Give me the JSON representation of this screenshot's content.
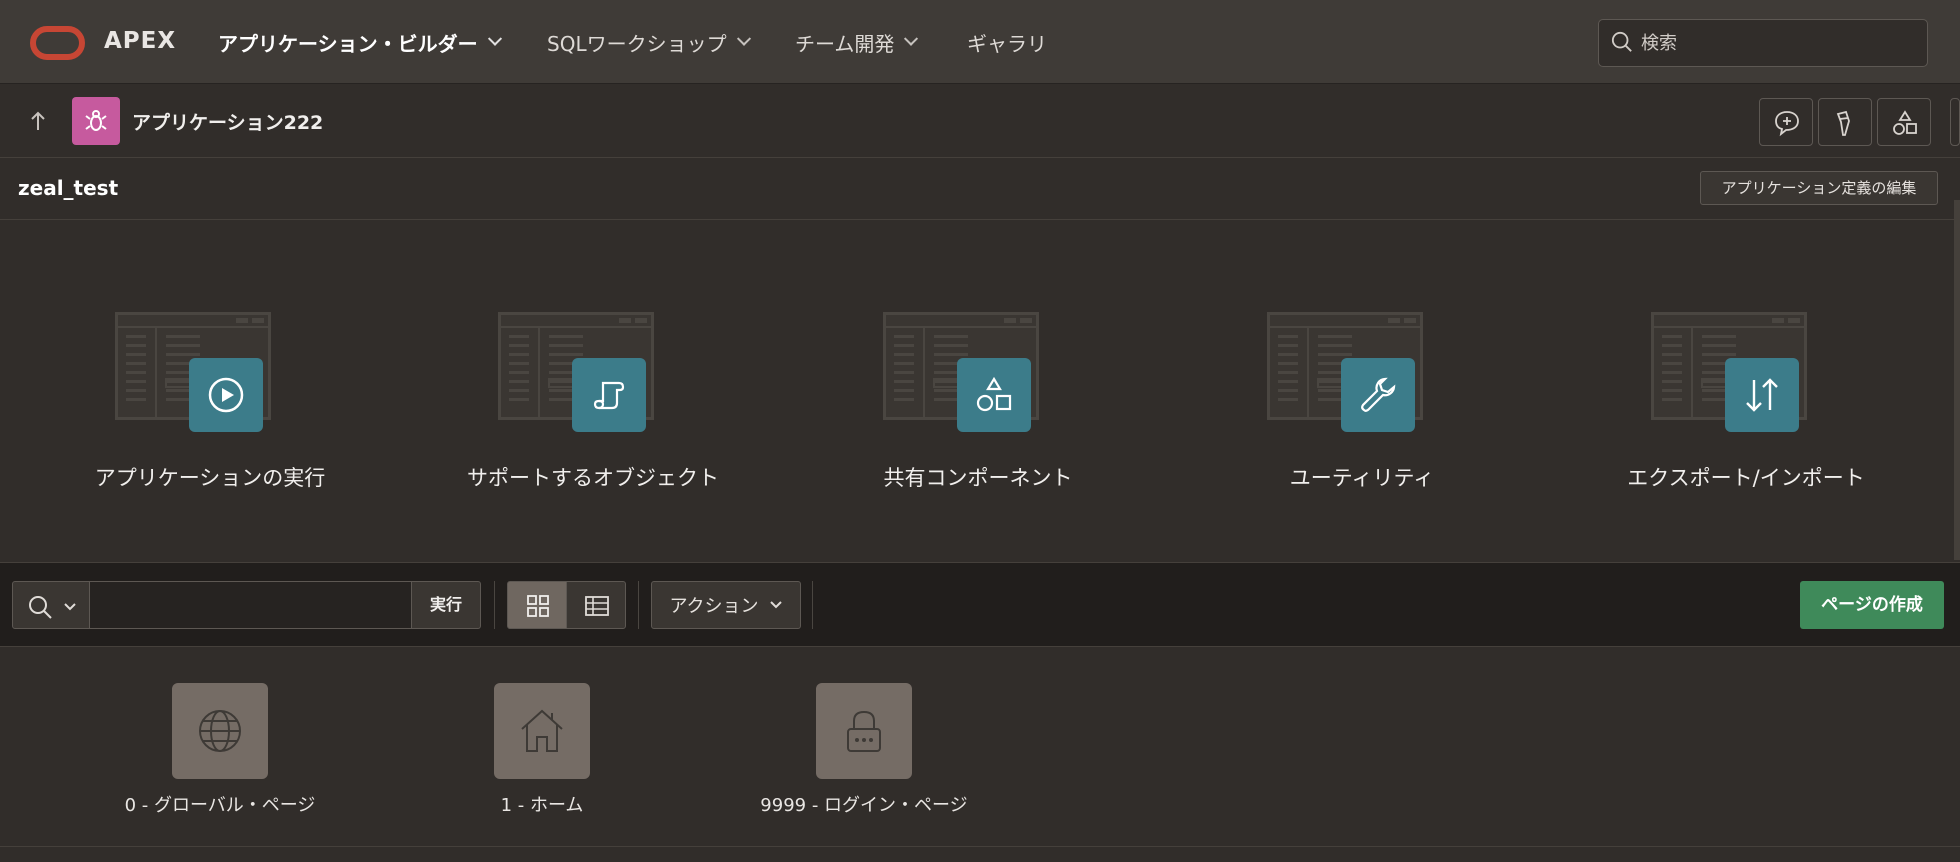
{
  "topnav": {
    "brand": "APEX",
    "items": [
      {
        "label": "アプリケーション・ビルダー",
        "active": true
      },
      {
        "label": "SQLワークショップ",
        "active": false
      },
      {
        "label": "チーム開発",
        "active": false
      },
      {
        "label": "ギャラリ",
        "active": false
      }
    ],
    "search_placeholder": "検索"
  },
  "appbar": {
    "app_name": "アプリケーション222",
    "app_icon_color": "#c65a9e"
  },
  "header": {
    "title": "zeal_test",
    "edit_definition_label": "アプリケーション定義の編集"
  },
  "cards": [
    {
      "label": "アプリケーションの実行",
      "icon": "play-icon"
    },
    {
      "label": "サポートするオブジェクト",
      "icon": "scroll-icon"
    },
    {
      "label": "共有コンポーネント",
      "icon": "shapes-icon"
    },
    {
      "label": "ユーティリティ",
      "icon": "wrench-icon"
    },
    {
      "label": "エクスポート/インポート",
      "icon": "transfer-arrows-icon"
    }
  ],
  "toolbar": {
    "go_label": "実行",
    "actions_label": "アクション",
    "create_page_label": "ページの作成",
    "filter_value": ""
  },
  "pages": [
    {
      "label": "0 - グローバル・ページ",
      "icon": "globe-icon"
    },
    {
      "label": "1 - ホーム",
      "icon": "home-icon"
    },
    {
      "label": "9999 - ログイン・ページ",
      "icon": "lock-icon"
    }
  ],
  "colors": {
    "accent_teal": "#3c7c8a",
    "create_green": "#3f8a5a",
    "oracle_red": "#c74634"
  }
}
